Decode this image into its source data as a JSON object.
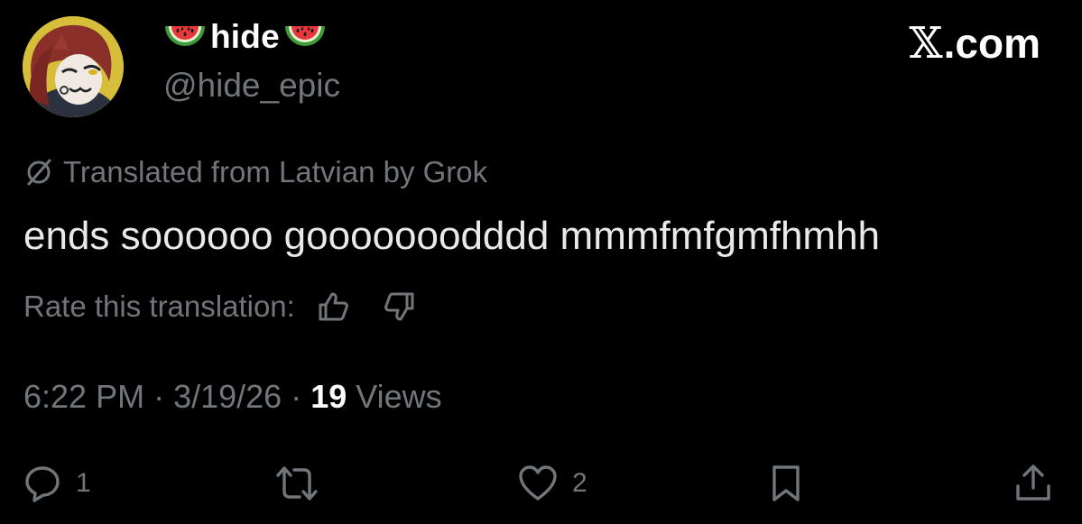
{
  "author": {
    "display_name": "hide",
    "handle": "@hide_epic",
    "name_emoji": "watermelon-icon"
  },
  "site": {
    "logo_text": ".com",
    "logo_glyph": "𝕏"
  },
  "translation": {
    "notice": "Translated from Latvian by Grok",
    "rate_label": "Rate this translation:"
  },
  "tweet": {
    "text": "ends soooooo gooooooodddd mmmfmfgmfhmhh"
  },
  "meta": {
    "time": "6:22 PM",
    "separator": " · ",
    "date": "3/19/26",
    "views_count": "19",
    "views_label": " Views"
  },
  "actions": {
    "reply_count": "1",
    "retweet_count": "",
    "like_count": "2"
  },
  "colors": {
    "background": "#000000",
    "primary_text": "#e7e9ea",
    "secondary_text": "#71767b"
  }
}
